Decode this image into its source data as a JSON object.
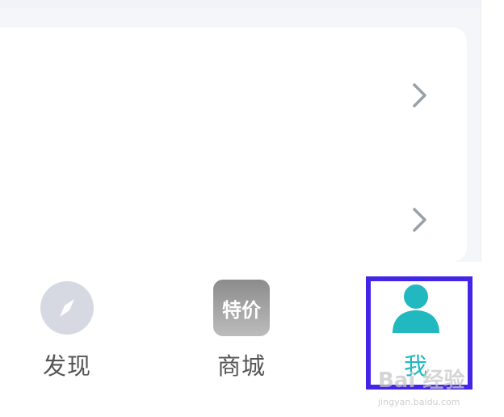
{
  "settings_list": {
    "rows": [
      {
        "chevron_icon": "chevron-right-icon"
      },
      {
        "chevron_icon": "chevron-right-icon"
      }
    ]
  },
  "tabbar": {
    "tabs": [
      {
        "label": "发现",
        "icon": "compass-icon",
        "active": false
      },
      {
        "label": "商城",
        "icon_text": "特价",
        "icon": "special-price-icon",
        "active": false
      },
      {
        "label": "我",
        "icon": "person-icon",
        "active": true
      }
    ]
  },
  "highlight": {
    "color": "#4325e6"
  },
  "colors": {
    "active_tab": "#22b8c0",
    "inactive_tab": "#555555",
    "discover_icon_bg": "#d6d9e2"
  },
  "watermark": {
    "brand": "Bai 经验",
    "url": "jingyan.baidu.com"
  }
}
